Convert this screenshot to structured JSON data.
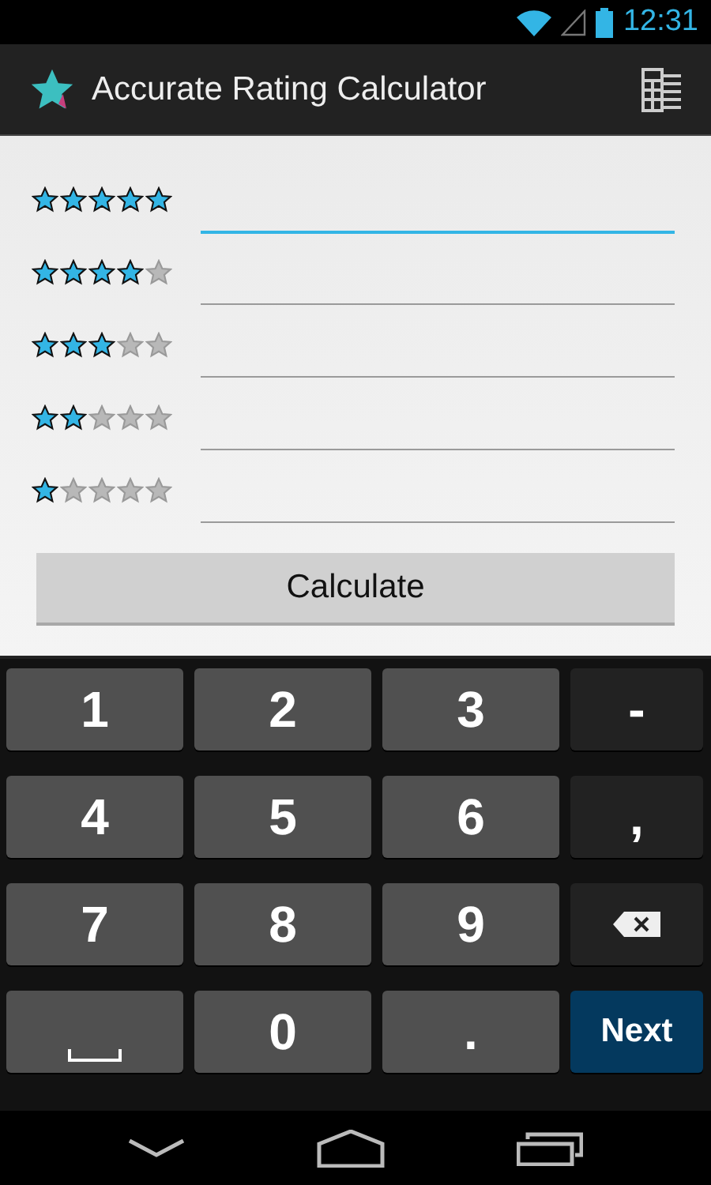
{
  "status_bar": {
    "time": "12:31"
  },
  "app_bar": {
    "title": "Accurate Rating Calculator"
  },
  "ratings": [
    {
      "stars": 5,
      "focused": true
    },
    {
      "stars": 4,
      "focused": false
    },
    {
      "stars": 3,
      "focused": false
    },
    {
      "stars": 2,
      "focused": false
    },
    {
      "stars": 1,
      "focused": false
    }
  ],
  "calculate_button": "Calculate",
  "keyboard": [
    {
      "kind": "digit",
      "label": "1"
    },
    {
      "kind": "digit",
      "label": "2"
    },
    {
      "kind": "digit",
      "label": "3"
    },
    {
      "kind": "symbol",
      "label": "-"
    },
    {
      "kind": "digit",
      "label": "4"
    },
    {
      "kind": "digit",
      "label": "5"
    },
    {
      "kind": "digit",
      "label": "6"
    },
    {
      "kind": "symbol",
      "label": ","
    },
    {
      "kind": "digit",
      "label": "7"
    },
    {
      "kind": "digit",
      "label": "8"
    },
    {
      "kind": "digit",
      "label": "9"
    },
    {
      "kind": "backspace"
    },
    {
      "kind": "space"
    },
    {
      "kind": "digit",
      "label": "0"
    },
    {
      "kind": "digit",
      "label": "."
    },
    {
      "kind": "action",
      "label": "Next"
    }
  ]
}
